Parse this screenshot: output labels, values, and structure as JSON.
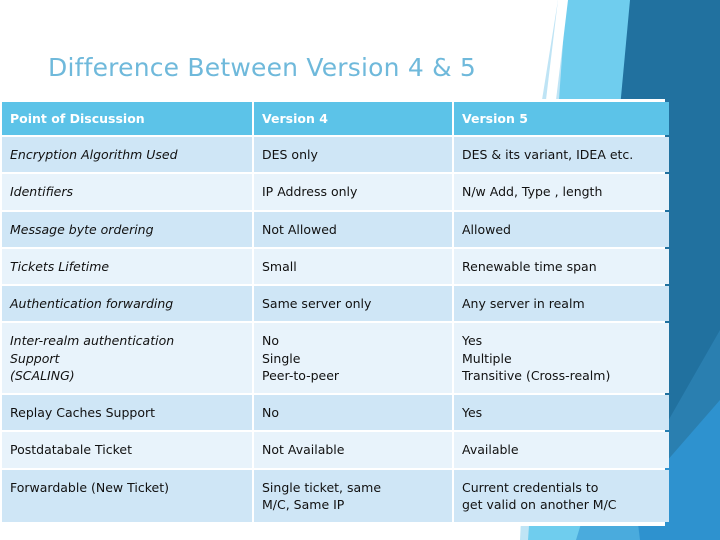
{
  "slide": {
    "title": "Difference Between Version 4 & 5",
    "title_color": "#6fb9db",
    "background_color": "#ffffff"
  },
  "decoration": {
    "name": "angled-band-graphic",
    "colors": {
      "pale_blue": "#bfe4f5",
      "light_blue": "#6fcdee",
      "sky_blue": "#4aabdd",
      "mid_blue": "#2e92cf",
      "steel_blue": "#2a7fb0",
      "deep_blue": "#21719f",
      "white": "#ffffff"
    }
  },
  "table": {
    "header_bg": "#5cc3e8",
    "header_text_color": "#ffffff",
    "row_band_a": "#cfe6f6",
    "row_band_b": "#e8f3fb",
    "headers": [
      "Point of Discussion",
      "Version 4",
      "Version 5"
    ],
    "rows": [
      {
        "point": "Encryption Algorithm Used",
        "v4": "DES only",
        "v5": "DES & its variant, IDEA etc.",
        "key_style": "italic",
        "band": "a"
      },
      {
        "point": "Identifiers",
        "v4": "IP Address only",
        "v5": "N/w  Add, Type , length",
        "key_style": "italic",
        "band": "b"
      },
      {
        "point": "Message byte ordering",
        "v4": "Not Allowed",
        "v5": "Allowed",
        "key_style": "italic",
        "band": "a"
      },
      {
        "point": "Tickets Lifetime",
        "v4": "Small",
        "v5": "Renewable time span",
        "key_style": "italic",
        "band": "b"
      },
      {
        "point": "Authentication forwarding",
        "v4": "Same server only",
        "v5": "Any server in realm",
        "key_style": "italic",
        "band": "a"
      },
      {
        "point": "Inter-realm authentication\nSupport\n(SCALING)",
        "v4": "No\nSingle\nPeer-to-peer",
        "v5": "Yes\nMultiple\nTransitive (Cross-realm)",
        "key_style": "italic-teal",
        "band": "b"
      },
      {
        "point": "Replay Caches Support",
        "v4": "No",
        "v5": "Yes",
        "key_style": "plain",
        "band": "a"
      },
      {
        "point": "Postdatabale Ticket",
        "v4": "Not Available",
        "v5": "Available",
        "key_style": "plain",
        "band": "b"
      },
      {
        "point": "Forwardable (New Ticket)",
        "v4": "Single ticket, same\nM/C, Same IP",
        "v5": "Current credentials to\nget valid on another M/C",
        "key_style": "plain",
        "band": "a"
      }
    ]
  }
}
